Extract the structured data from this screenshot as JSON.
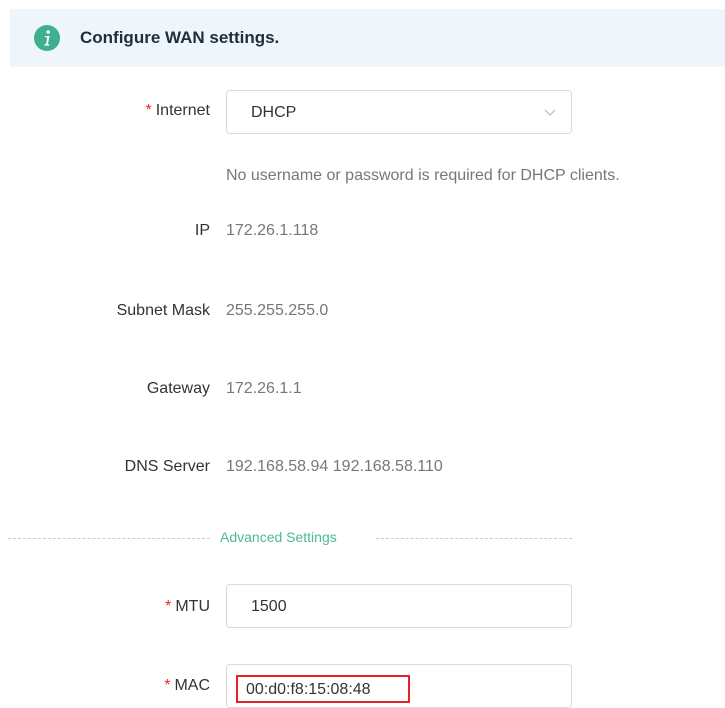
{
  "banner": {
    "icon": "info-icon",
    "text": "Configure WAN settings.",
    "icon_color": "#3fb08f"
  },
  "form": {
    "internet": {
      "required_mark": "*",
      "label": "Internet",
      "selected": "DHCP",
      "hint": "No username or password is required for DHCP clients."
    },
    "ip": {
      "label": "IP",
      "value": "172.26.1.118"
    },
    "subnet_mask": {
      "label": "Subnet Mask",
      "value": "255.255.255.0"
    },
    "gateway": {
      "label": "Gateway",
      "value": "172.26.1.1"
    },
    "dns_server": {
      "label": "DNS Server",
      "value": "192.168.58.94 192.168.58.110"
    },
    "advanced_divider": "Advanced Settings",
    "mtu": {
      "required_mark": "*",
      "label": "MTU",
      "value": "1500"
    },
    "mac": {
      "required_mark": "*",
      "label": "MAC",
      "value": "00:d0:f8:15:08:48",
      "highlight_color": "#e8202a"
    }
  }
}
